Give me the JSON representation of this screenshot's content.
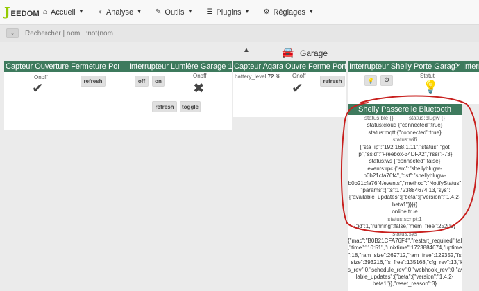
{
  "app": {
    "logo_letter": "J",
    "logo_text": "EEDOM"
  },
  "nav": {
    "items": [
      {
        "label": "Accueil",
        "icon": "home-icon"
      },
      {
        "label": "Analyse",
        "icon": "analytics-icon"
      },
      {
        "label": "Outils",
        "icon": "wrench-icon"
      },
      {
        "label": "Plugins",
        "icon": "list-icon"
      },
      {
        "label": "Réglages",
        "icon": "gears-icon"
      }
    ]
  },
  "search": {
    "placeholder": "Rechercher | nom | :not(nom"
  },
  "object": {
    "title": "Garage",
    "icon": "car-icon"
  },
  "cards": {
    "c1": {
      "title": "Capteur Ouverture Fermeture Port",
      "cmd_label": "Onoff",
      "refresh": "refresh"
    },
    "c2": {
      "title": "Interrupteur Lumière Garage 1",
      "off": "off",
      "on": "on",
      "cmd_label": "Onoff",
      "refresh": "refresh",
      "toggle": "toggle"
    },
    "c3": {
      "title": "Capteur Aqara Ouvre Ferme Porte",
      "battery_label": "battery_level",
      "battery_value": "72 %",
      "cmd_label": "Onoff",
      "refresh": "refresh"
    },
    "c4": {
      "title": "Interrupteur Shelly Porte Garag",
      "status_label": "Statut"
    },
    "c5": {
      "title": "Interrupteur"
    }
  },
  "shelly": {
    "title": "Shelly Passerelle Bluetooth",
    "lines": [
      {
        "text": "status:ble {}          status:blugw {}",
        "kind": "lbl"
      },
      {
        "text": "status:cloud {\"connected\":true}",
        "kind": "val"
      },
      {
        "text": "status:mqtt {\"connected\":true}",
        "kind": "val"
      },
      {
        "text": "status:wifi",
        "kind": "lbl"
      },
      {
        "text": "{\"sta_ip\":\"192.168.1.11\",\"status\":\"got",
        "kind": "val"
      },
      {
        "text": "ip\",\"ssid\":\"Freebox-34DFA2\",\"rssi\":-73}",
        "kind": "val"
      },
      {
        "text": "status:ws {\"connected\":false}",
        "kind": "val"
      },
      {
        "text": "events:rpc {\"src\":\"shellyblugw-",
        "kind": "val"
      },
      {
        "text": "b0b21cfa76f4\",\"dst\":\"shellyblugw-",
        "kind": "val"
      },
      {
        "text": "b0b21cfa76f4/events\",\"method\":\"NotifyStatus\"",
        "kind": "val"
      },
      {
        "text": ",\"params\":{\"ts\":1723884674.13,\"sys\":",
        "kind": "val"
      },
      {
        "text": "{\"available_updates\":{\"beta\":{\"version\":\"1.4.2-",
        "kind": "val"
      },
      {
        "text": "beta1\"}}}}}",
        "kind": "val"
      },
      {
        "text": "online true",
        "kind": "val"
      },
      {
        "text": "status:script:1",
        "kind": "lbl"
      },
      {
        "text": "{\"id\":1,\"running\":false,\"mem_free\":25200}",
        "kind": "val"
      },
      {
        "text": "status:sys",
        "kind": "lbl"
      },
      {
        "text": "{\"mac\":\"B0B21CFA76F4\",\"restart_required\":false",
        "kind": "val"
      },
      {
        "text": ",\"time\":\"10:51\",\"unixtime\":1723884674,\"uptime",
        "kind": "val"
      },
      {
        "text": "\":18,\"ram_size\":269712,\"ram_free\":129352,\"fs",
        "kind": "val"
      },
      {
        "text": "_size\":393216,\"fs_free\":135168,\"cfg_rev\":13,\"kv",
        "kind": "val"
      },
      {
        "text": "s_rev\":0,\"schedule_rev\":0,\"webhook_rev\":0,\"avai",
        "kind": "val"
      },
      {
        "text": "lable_updates\":{\"beta\":{\"version\":\"1.4.2-",
        "kind": "val"
      },
      {
        "text": "beta1\"}},\"reset_reason\":3}",
        "kind": "val"
      }
    ]
  },
  "colors": {
    "header_green": "#3e7a5d",
    "annotation_red": "#c8201e",
    "logo_green": "#94ca02"
  }
}
